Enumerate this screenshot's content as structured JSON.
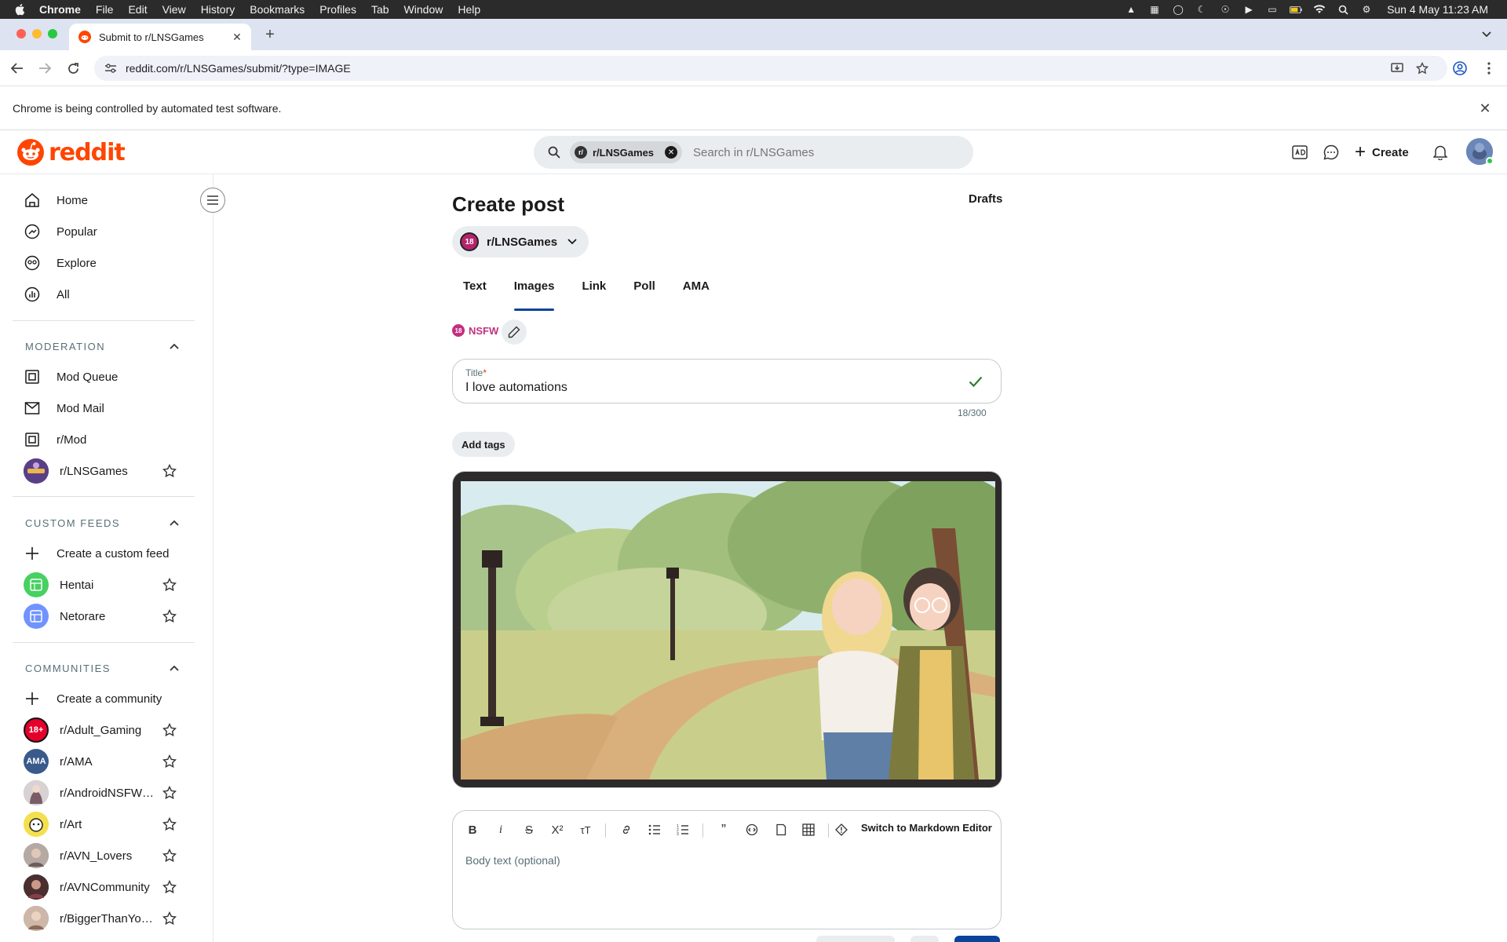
{
  "os": {
    "app_name": "Chrome",
    "menus": [
      "File",
      "Edit",
      "View",
      "History",
      "Bookmarks",
      "Profiles",
      "Tab",
      "Window",
      "Help"
    ],
    "clock": "Sun 4 May  11:23 AM"
  },
  "browser": {
    "tab_title": "Submit to r/LNSGames",
    "url": "reddit.com/r/LNSGames/submit/?type=IMAGE",
    "infobar_message": "Chrome is being controlled by automated test software."
  },
  "header": {
    "logo_text": "reddit",
    "search_chip": "r/LNSGames",
    "search_placeholder": "Search in r/LNSGames",
    "create_label": "Create"
  },
  "sidebar": {
    "nav": [
      {
        "label": "Home",
        "icon": "home-icon"
      },
      {
        "label": "Popular",
        "icon": "popular-icon"
      },
      {
        "label": "Explore",
        "icon": "explore-icon"
      },
      {
        "label": "All",
        "icon": "all-icon"
      }
    ],
    "moderation": {
      "title": "MODERATION",
      "items": [
        {
          "label": "Mod Queue",
          "icon": "mod-queue-icon"
        },
        {
          "label": "Mod Mail",
          "icon": "mod-mail-icon"
        },
        {
          "label": "r/Mod",
          "icon": "mod-icon"
        },
        {
          "label": "r/LNSGames",
          "icon": "community-avatar"
        }
      ]
    },
    "custom_feeds": {
      "title": "CUSTOM FEEDS",
      "create_label": "Create a custom feed",
      "items": [
        {
          "label": "Hentai",
          "color": "#46d160"
        },
        {
          "label": "Netorare",
          "color": "#7193ff"
        }
      ]
    },
    "communities": {
      "title": "COMMUNITIES",
      "create_label": "Create a community",
      "items": [
        {
          "label": "r/Adult_Gaming",
          "avatar_text": "18+",
          "color": "#e4002b"
        },
        {
          "label": "r/AMA",
          "avatar_text": "AMA",
          "color": "#3a5a8c"
        },
        {
          "label": "r/AndroidNSFWg...",
          "avatar_text": "",
          "color": "#8a7c80"
        },
        {
          "label": "r/Art",
          "avatar_text": "",
          "color": "#f4e04d"
        },
        {
          "label": "r/AVN_Lovers",
          "avatar_text": "",
          "color": "#9a8a86"
        },
        {
          "label": "r/AVNCommunity",
          "avatar_text": "",
          "color": "#5a3d3d"
        },
        {
          "label": "r/BiggerThanYou...",
          "avatar_text": "",
          "color": "#a08070"
        }
      ]
    }
  },
  "post": {
    "heading": "Create post",
    "drafts_label": "Drafts",
    "subreddit": "r/LNSGames",
    "subreddit_badge": "18",
    "tabs": [
      "Text",
      "Images",
      "Link",
      "Poll",
      "AMA"
    ],
    "active_tab": "Images",
    "nsfw_label": "NSFW",
    "nsfw_badge": "18",
    "title_label": "Title",
    "title_required_mark": "*",
    "title_value": "I love automations",
    "char_count": "18/300",
    "add_tags_label": "Add tags",
    "markdown_switch_label": "Switch to Markdown Editor",
    "body_placeholder": "Body text (optional)"
  },
  "colors": {
    "reddit_orange": "#ff4500",
    "active_tab_underline": "#0a449b",
    "nsfw_pink": "#c4307e",
    "check_green": "#2e7d32"
  }
}
